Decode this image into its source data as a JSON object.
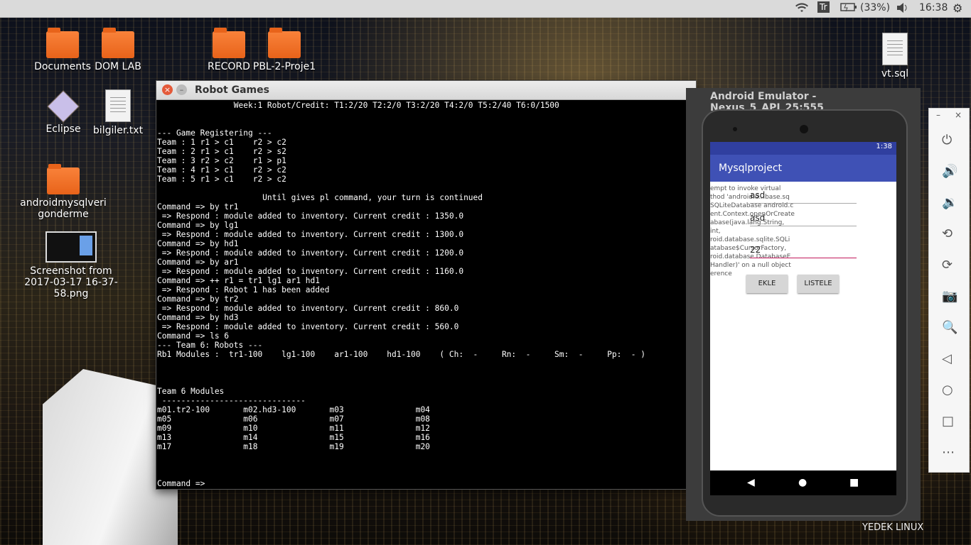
{
  "topbar": {
    "wifi_icon": "wifi-icon",
    "keyboard_layout": "Tr",
    "battery_percent": "(33%)",
    "time": "16:38"
  },
  "desktop": {
    "icons": [
      {
        "label": "Documents",
        "type": "folder"
      },
      {
        "label": "DOM LAB",
        "type": "folder"
      },
      {
        "label": "RECORD",
        "type": "folder"
      },
      {
        "label": "PBL-2-Proje1",
        "type": "folder"
      },
      {
        "label": "vt.sql",
        "type": "file"
      },
      {
        "label": "Eclipse",
        "type": "app"
      },
      {
        "label": "bilgiler.txt",
        "type": "file"
      },
      {
        "label": "androidmysqlverigonderme",
        "type": "folder"
      },
      {
        "label": "Screenshot from 2017-03-17 16-37-58.png",
        "type": "image"
      }
    ],
    "corner_label": "YEDEK LINUX"
  },
  "terminal": {
    "title": "Robot Games",
    "lines": [
      "                Week:1 Robot/Credit: T1:2/20 T2:2/0 T3:2/20 T4:2/0 T5:2/40 T6:0/1500",
      "",
      "",
      "--- Game Registering ---",
      "Team : 1 r1 > c1    r2 > c2",
      "Team : 2 r1 > c1    r2 > s2",
      "Team : 3 r2 > c2    r1 > p1",
      "Team : 4 r1 > c1    r2 > c2",
      "Team : 5 r1 > c1    r2 > c2",
      "",
      "                      Until gives pl command, your turn is continued",
      "Command => by tr1",
      " => Respond : module added to inventory. Current credit : 1350.0",
      "Command => by lg1",
      " => Respond : module added to inventory. Current credit : 1300.0",
      "Command => by hd1",
      " => Respond : module added to inventory. Current credit : 1200.0",
      "Command => by ar1",
      " => Respond : module added to inventory. Current credit : 1160.0",
      "Command => ++ r1 = tr1 lg1 ar1 hd1",
      " => Respond : Robot 1 has been added",
      "Command => by tr2",
      " => Respond : module added to inventory. Current credit : 860.0",
      "Command => by hd3",
      " => Respond : module added to inventory. Current credit : 560.0",
      "Command => ls 6",
      "--- Team 6: Robots ---",
      "Rb1 Modules :  tr1-100    lg1-100    ar1-100    hd1-100    ( Ch:  -     Rn:  -     Sm:  -     Pp:  - )",
      "",
      "",
      "",
      "Team 6 Modules",
      " ------------------------------",
      "m01.tr2-100       m02.hd3-100       m03               m04",
      "m05               m06               m07               m08",
      "m09               m10               m11               m12",
      "m13               m14               m15               m16",
      "m17               m18               m19               m20",
      "",
      "",
      "",
      "Command =>"
    ]
  },
  "emulator": {
    "title": "Android Emulator - Nexus_5_API_25:555",
    "status_time": "1:38",
    "app_title": "Mysqlproject",
    "error_text": "empt to invoke virtual thod 'android.d...base.sq SQLiteDatabase android.c ent.Context.openOrCreate abase(java.lang.String, int, roid.database.sqlite.SQLi atabase$CursorFactory, roid.database.DatabaseE Handler)' on a null object erence",
    "field1": "asd",
    "field2": "asd",
    "field3": "22",
    "btn_add": "EKLE",
    "btn_list": "LISTELE"
  }
}
